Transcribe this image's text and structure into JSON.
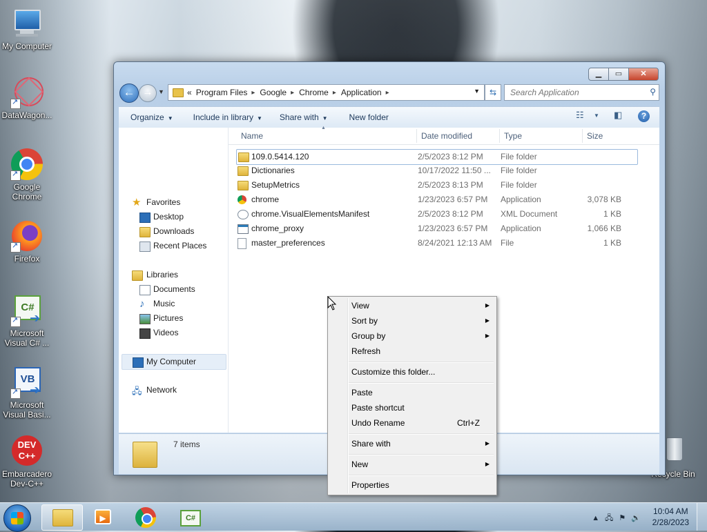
{
  "desktop": {
    "icons": [
      {
        "label": "My Computer"
      },
      {
        "label": "DataWagon..."
      },
      {
        "label": "Google Chrome"
      },
      {
        "label": "Firefox"
      },
      {
        "label": "Microsoft Visual C# ..."
      },
      {
        "label": "Microsoft Visual Basi..."
      },
      {
        "label": "Embarcadero Dev-C++"
      },
      {
        "label": "Recycle Bin"
      }
    ]
  },
  "window": {
    "controls": {
      "minimize": "▁",
      "maximize": "▭",
      "close": "✕"
    },
    "address": {
      "prefix": "«",
      "crumbs": [
        "Program Files",
        "Google",
        "Chrome",
        "Application"
      ]
    },
    "search": {
      "placeholder": "Search Application"
    },
    "toolbar": {
      "organize": "Organize",
      "include_in_library": "Include in library",
      "share_with": "Share with",
      "new_folder": "New folder"
    },
    "nav": {
      "favorites": "Favorites",
      "desktop": "Desktop",
      "downloads": "Downloads",
      "recent_places": "Recent Places",
      "libraries": "Libraries",
      "documents": "Documents",
      "music": "Music",
      "pictures": "Pictures",
      "videos": "Videos",
      "my_computer": "My Computer",
      "network": "Network"
    },
    "columns": {
      "name": "Name",
      "date": "Date modified",
      "type": "Type",
      "size": "Size"
    },
    "files": [
      {
        "name": "109.0.5414.120",
        "date": "2/5/2023 8:12 PM",
        "type": "File folder",
        "size": ""
      },
      {
        "name": "Dictionaries",
        "date": "10/17/2022 11:50 ...",
        "type": "File folder",
        "size": ""
      },
      {
        "name": "SetupMetrics",
        "date": "2/5/2023 8:13 PM",
        "type": "File folder",
        "size": ""
      },
      {
        "name": "chrome",
        "date": "1/23/2023 6:57 PM",
        "type": "Application",
        "size": "3,078 KB"
      },
      {
        "name": "chrome.VisualElementsManifest",
        "date": "2/5/2023 8:12 PM",
        "type": "XML Document",
        "size": "1 KB"
      },
      {
        "name": "chrome_proxy",
        "date": "1/23/2023 6:57 PM",
        "type": "Application",
        "size": "1,066 KB"
      },
      {
        "name": "master_preferences",
        "date": "8/24/2021 12:13 AM",
        "type": "File",
        "size": "1 KB"
      }
    ],
    "status": {
      "count": "7 items"
    }
  },
  "context_menu": {
    "view": "View",
    "sort_by": "Sort by",
    "group_by": "Group by",
    "refresh": "Refresh",
    "customize": "Customize this folder...",
    "paste": "Paste",
    "paste_shortcut": "Paste shortcut",
    "undo_rename": "Undo Rename",
    "undo_shortcut": "Ctrl+Z",
    "share_with": "Share with",
    "new": "New",
    "properties": "Properties"
  },
  "taskbar": {
    "time": "10:04 AM",
    "date": "2/28/2023"
  },
  "colors": {
    "accent": "#3a6ea5",
    "selection": "#9ab9dd"
  }
}
